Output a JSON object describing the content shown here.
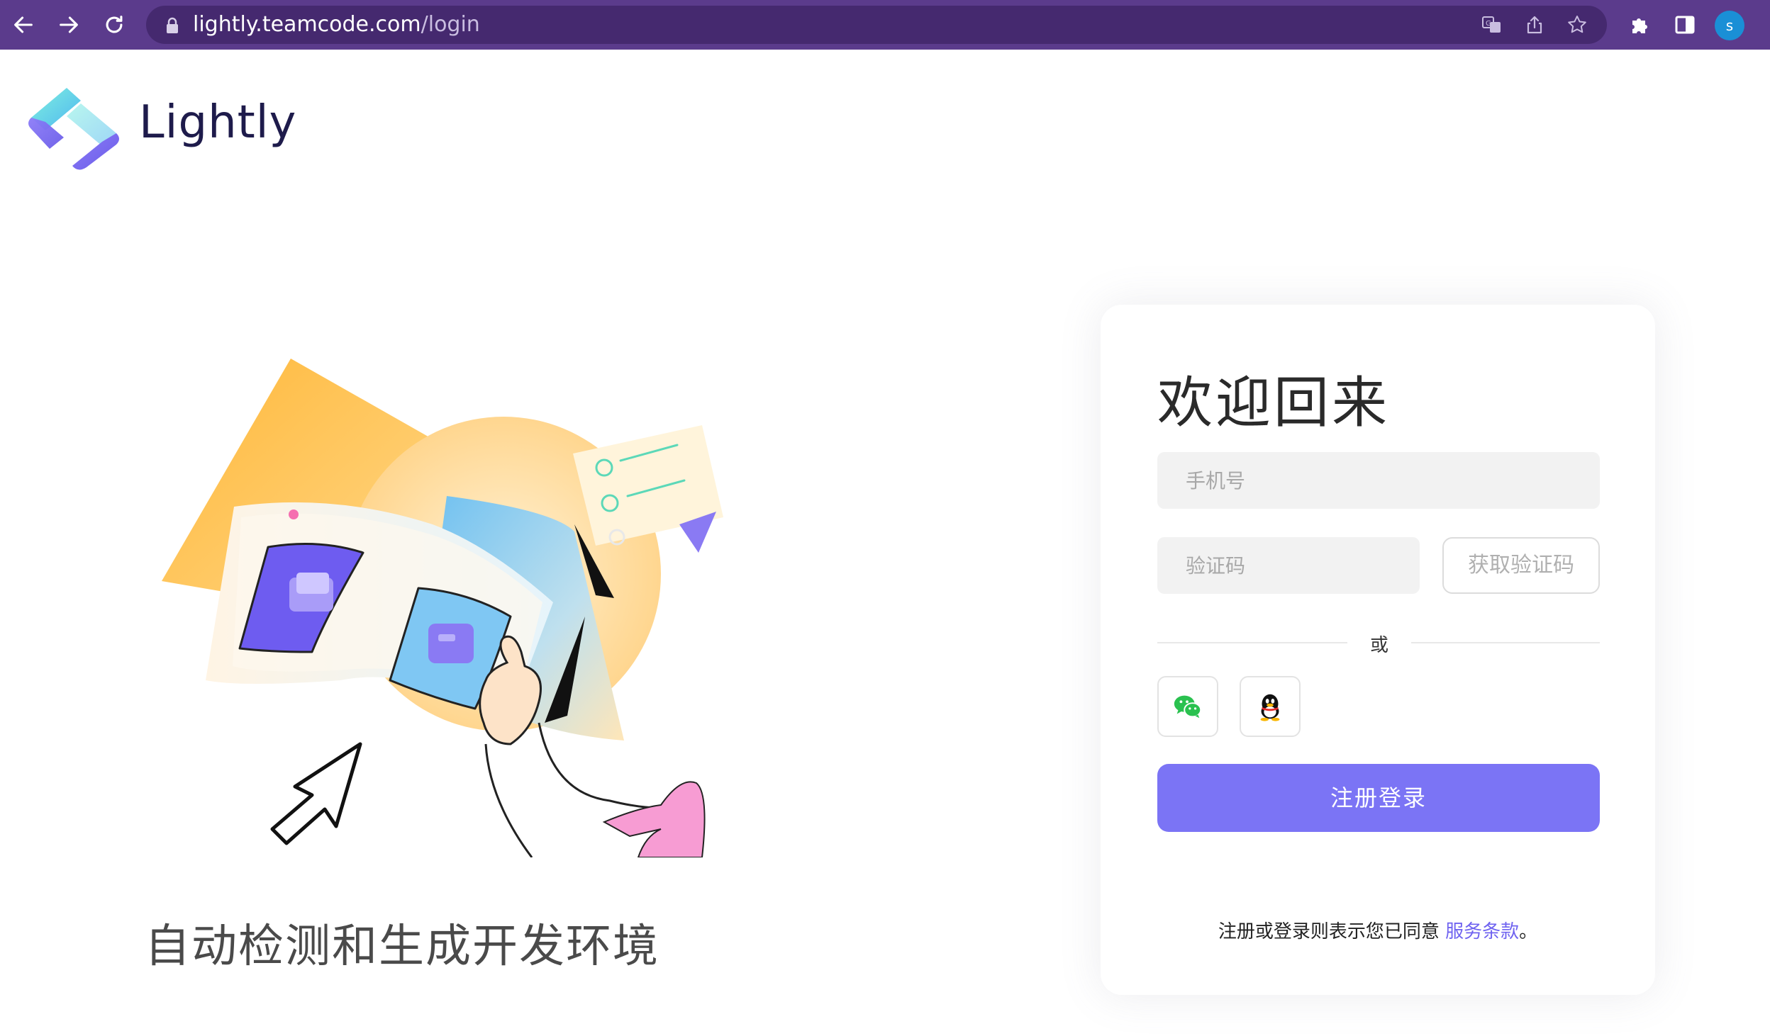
{
  "browser": {
    "url_host": "lightly.teamcode.com",
    "url_path": "/login",
    "avatar_initial": "s"
  },
  "brand": {
    "name": "Lightly",
    "colors": {
      "teal": "#5de0e6",
      "purple": "#7b74f5",
      "navy": "#1e1b4b"
    }
  },
  "hero": {
    "tagline": "自动检测和生成开发环境"
  },
  "login": {
    "title": "欢迎回来",
    "phone_placeholder": "手机号",
    "code_placeholder": "验证码",
    "get_code_label": "获取验证码",
    "divider_label": "或",
    "social": [
      "wechat-icon",
      "qq-icon"
    ],
    "submit_label": "注册登录",
    "terms_prefix": "注册或登录则表示您已同意 ",
    "terms_link": "服务条款",
    "terms_suffix": "。"
  }
}
